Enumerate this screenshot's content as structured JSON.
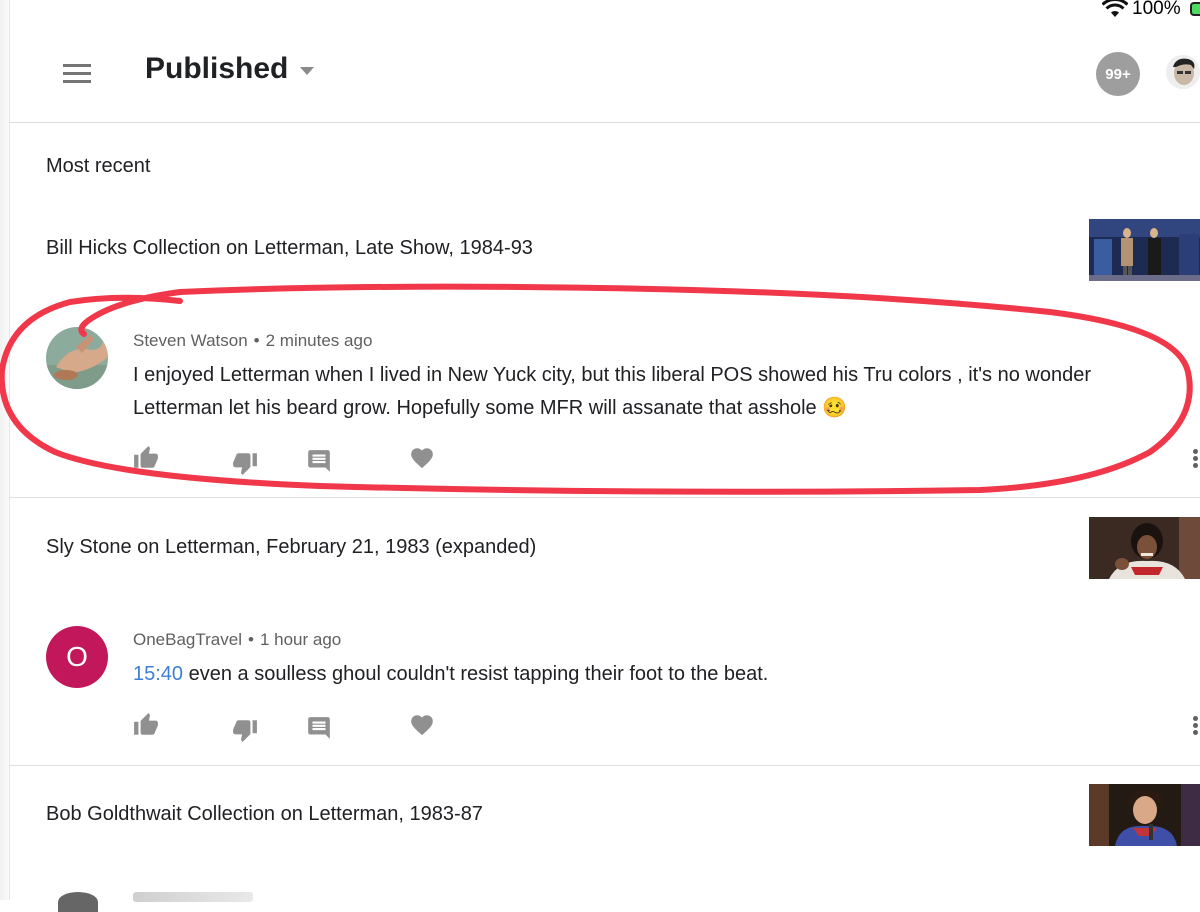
{
  "status_bar": {
    "battery_text": "100%",
    "wifi_icon": "wifi-icon",
    "battery_icon": "battery-icon"
  },
  "header": {
    "title": "Published",
    "notification_count": "99+",
    "menu_icon": "hamburger-menu-icon",
    "dropdown_icon": "caret-down-icon"
  },
  "section_label": "Most recent",
  "items": [
    {
      "video_title": "Bill Hicks Collection on Letterman, Late Show, 1984-93",
      "comment": {
        "author": "Steven Watson",
        "time": "2 minutes ago",
        "text": "I enjoyed Letterman when I lived in New Yuck city, but this liberal POS showed his Tru colors , it's no wonder Letterman let his beard grow. Hopefully some MFR will assanate that  asshole 🥴"
      }
    },
    {
      "video_title": "Sly Stone on Letterman, February 21, 1983 (expanded)",
      "comment": {
        "author": "OneBagTravel",
        "avatar_letter": "O",
        "time": "1 hour ago",
        "timestamp_link": "15:40",
        "text": " even a soulless ghoul couldn't resist tapping their foot to the beat."
      }
    },
    {
      "video_title": "Bob Goldthwait Collection on Letterman, 1983-87"
    }
  ],
  "colors": {
    "annotation_red": "#f0384a",
    "link_blue": "#3e7fd6",
    "avatar_magenta": "#c2185b"
  }
}
